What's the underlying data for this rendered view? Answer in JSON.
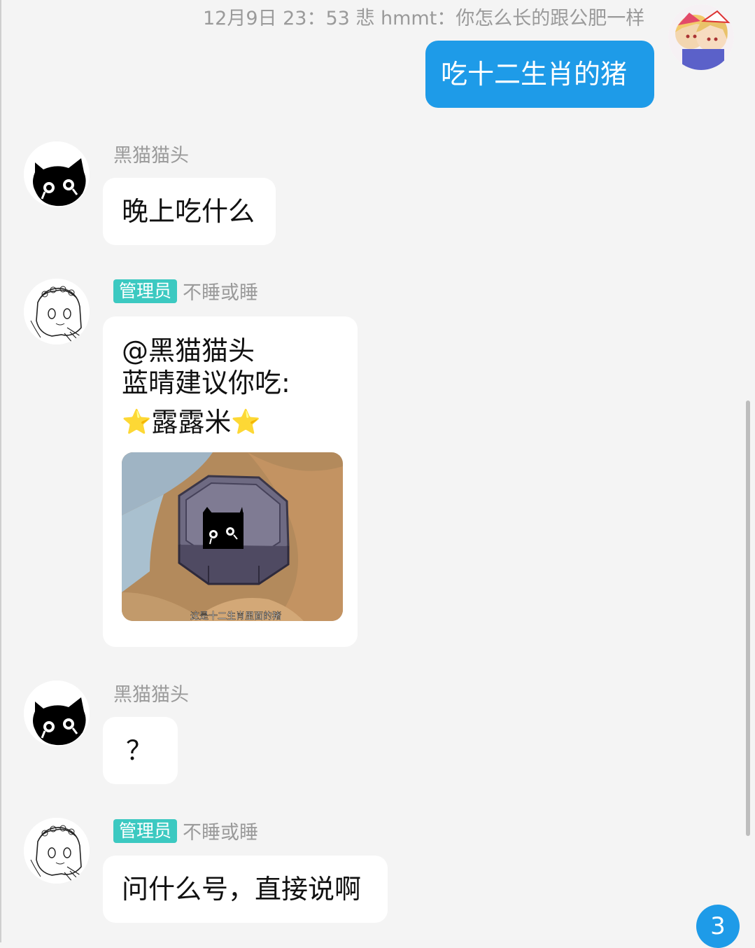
{
  "quote": "12月9日 23：53 悲 hmmt：你怎么长的跟公肥一样",
  "messages": [
    {
      "sender": "self",
      "text": "吃十二生肖的猪"
    },
    {
      "sender": "黑猫猫头",
      "text": "晚上吃什么"
    },
    {
      "sender": "不睡或睡",
      "role": "管理员",
      "lines": [
        "@黑猫猫头",
        "蓝晴建议你吃:",
        "露露米"
      ],
      "star": "⭐",
      "image_caption": "这是十二生肖里面的猪"
    },
    {
      "sender": "黑猫猫头",
      "text": "？"
    },
    {
      "sender": "不睡或睡",
      "role": "管理员",
      "text": "问什么号，直接说啊"
    }
  ],
  "unread_count": "3",
  "colors": {
    "accent": "#1e9be8",
    "admin_badge": "#3cc9c1",
    "background": "#f4f4f4"
  },
  "icons": {
    "cat_avatar": "black-cat-avatar-icon",
    "admin_avatar": "sketch-girl-avatar-icon",
    "self_avatar": "anime-avatar-icon"
  }
}
